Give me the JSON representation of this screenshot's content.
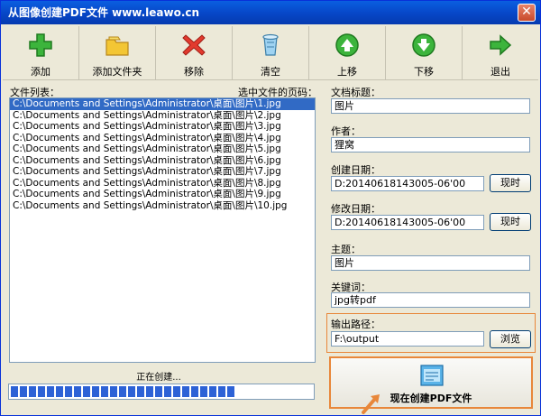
{
  "window": {
    "title": "从图像创建PDF文件 www.leawo.cn",
    "close_glyph": "✕"
  },
  "toolbar": [
    {
      "label": "添加",
      "icon": "add-icon"
    },
    {
      "label": "添加文件夹",
      "icon": "folder-icon"
    },
    {
      "label": "移除",
      "icon": "remove-icon"
    },
    {
      "label": "清空",
      "icon": "clear-icon"
    },
    {
      "label": "上移",
      "icon": "move-up-icon"
    },
    {
      "label": "下移",
      "icon": "move-down-icon"
    },
    {
      "label": "退出",
      "icon": "exit-icon"
    }
  ],
  "file_list": {
    "label": "文件列表：",
    "page_label": "选中文件的页码：",
    "items": [
      "C:\\Documents and Settings\\Administrator\\桌面\\图片\\1.jpg",
      "C:\\Documents and Settings\\Administrator\\桌面\\图片\\2.jpg",
      "C:\\Documents and Settings\\Administrator\\桌面\\图片\\3.jpg",
      "C:\\Documents and Settings\\Administrator\\桌面\\图片\\4.jpg",
      "C:\\Documents and Settings\\Administrator\\桌面\\图片\\5.jpg",
      "C:\\Documents and Settings\\Administrator\\桌面\\图片\\6.jpg",
      "C:\\Documents and Settings\\Administrator\\桌面\\图片\\7.jpg",
      "C:\\Documents and Settings\\Administrator\\桌面\\图片\\8.jpg",
      "C:\\Documents and Settings\\Administrator\\桌面\\图片\\9.jpg",
      "C:\\Documents and Settings\\Administrator\\桌面\\图片\\10.jpg"
    ],
    "selected_index": 0
  },
  "status": {
    "text": "正在创建..."
  },
  "progress": {
    "fraction": 0.76
  },
  "fields": {
    "title_label": "文档标题：",
    "title_value": "图片",
    "author_label": "作者：",
    "author_value": "狸窝",
    "created_label": "创建日期：",
    "created_value": "D:20140618143005-06'00",
    "modified_label": "修改日期：",
    "modified_value": "D:20140618143005-06'00",
    "subject_label": "主题：",
    "subject_value": "图片",
    "keywords_label": "关键词：",
    "keywords_value": "jpg转pdf",
    "output_label": "输出路径：",
    "output_value": "F:\\output"
  },
  "buttons": {
    "now": "现时",
    "browse": "浏览",
    "create": "现在创建PDF文件"
  },
  "colors": {
    "accent_orange": "#e8873a",
    "selection": "#316ac5",
    "progress": "#2d62d6"
  }
}
